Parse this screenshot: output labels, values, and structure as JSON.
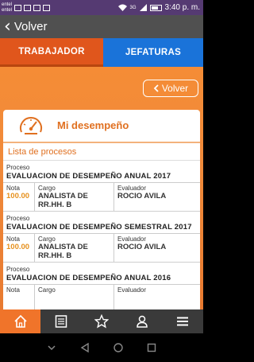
{
  "status_bar": {
    "carrier_top": "entel",
    "carrier_bottom": "entel",
    "network": "3G",
    "time": "3:40 p. m."
  },
  "app_bar": {
    "back_label": "Volver"
  },
  "tabs": [
    {
      "label": "TRABAJADOR",
      "active": true
    },
    {
      "label": "JEFATURAS",
      "active": false
    }
  ],
  "content": {
    "volver_button": "Volver",
    "card_title": "Mi desempeño",
    "list_title": "Lista de procesos",
    "labels": {
      "proceso": "Proceso",
      "nota": "Nota",
      "cargo": "Cargo",
      "evaluador": "Evaluador"
    },
    "processes": [
      {
        "name": "EVALUACION DE DESEMPEÑO ANUAL 2017",
        "nota": "100.00",
        "cargo": "ANALISTA DE RR.HH. B",
        "evaluador": "ROCIO AVILA"
      },
      {
        "name": "EVALUACION DE DESEMPEÑO SEMESTRAL 2017",
        "nota": "100.00",
        "cargo": "ANALISTA DE RR.HH. B",
        "evaluador": "ROCIO AVILA"
      },
      {
        "name": "EVALUACION DE DESEMPEÑO ANUAL 2016",
        "nota": "",
        "cargo": "",
        "evaluador": ""
      }
    ]
  },
  "bottom_nav": [
    {
      "icon": "home-icon",
      "active": true
    },
    {
      "icon": "document-icon",
      "active": false
    },
    {
      "icon": "star-icon",
      "active": false
    },
    {
      "icon": "person-icon",
      "active": false
    },
    {
      "icon": "menu-icon",
      "active": false
    }
  ],
  "colors": {
    "accent_orange": "#e0561c",
    "tab_blue": "#1a73d9",
    "app_bar": "#505050",
    "nota_color": "#e6901c"
  }
}
